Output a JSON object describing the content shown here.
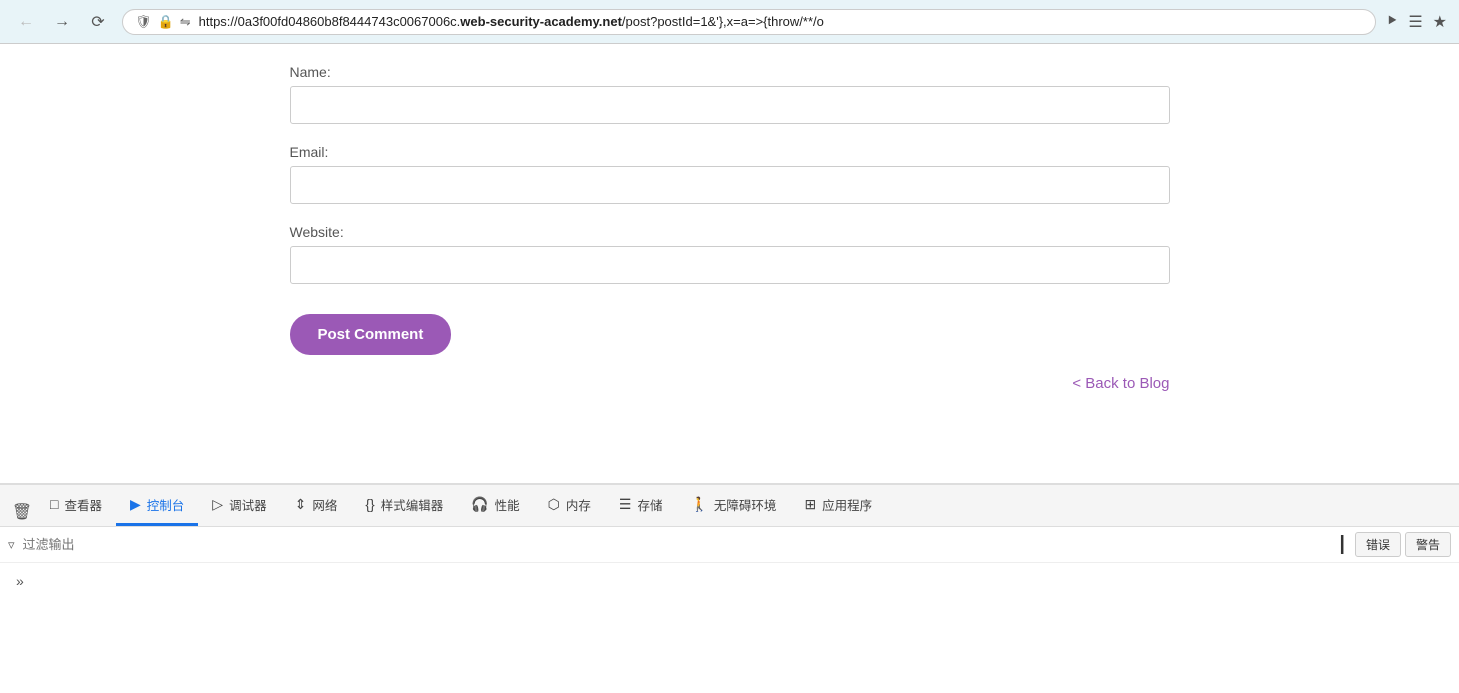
{
  "browser": {
    "url_prefix": "https://0a3f00fd04860b8f8444743c0067006c.",
    "url_domain": "web-security-academy.net",
    "url_suffix": "/post?postId=1&'},x=a=>{throw/**/o",
    "icons": {
      "shield": "🛡",
      "lock": "🔒",
      "redirect": "⇄"
    }
  },
  "form": {
    "name_label": "Name:",
    "email_label": "Email:",
    "website_label": "Website:",
    "name_placeholder": "",
    "email_placeholder": "",
    "website_placeholder": "",
    "submit_label": "Post Comment",
    "back_to_blog_label": "< Back to Blog"
  },
  "devtools": {
    "tabs": [
      {
        "id": "inspector",
        "label": "查看器",
        "icon": "⬜"
      },
      {
        "id": "console",
        "label": "控制台",
        "icon": "▷",
        "active": true
      },
      {
        "id": "debugger",
        "label": "调试器",
        "icon": "▷"
      },
      {
        "id": "network",
        "label": "网络",
        "icon": "↕"
      },
      {
        "id": "style-editor",
        "label": "样式编辑器",
        "icon": "{}"
      },
      {
        "id": "performance",
        "label": "性能",
        "icon": "🎧"
      },
      {
        "id": "memory",
        "label": "内存",
        "icon": "⬡"
      },
      {
        "id": "storage",
        "label": "存储",
        "icon": "☰"
      },
      {
        "id": "accessibility",
        "label": "无障碍环境",
        "icon": "🚶"
      },
      {
        "id": "application",
        "label": "应用程序",
        "icon": "⊞"
      }
    ],
    "toolbar": {
      "filter_placeholder": "过滤输出",
      "error_btn": "错误",
      "warning_btn": "警告"
    },
    "console_expand": ">>"
  }
}
